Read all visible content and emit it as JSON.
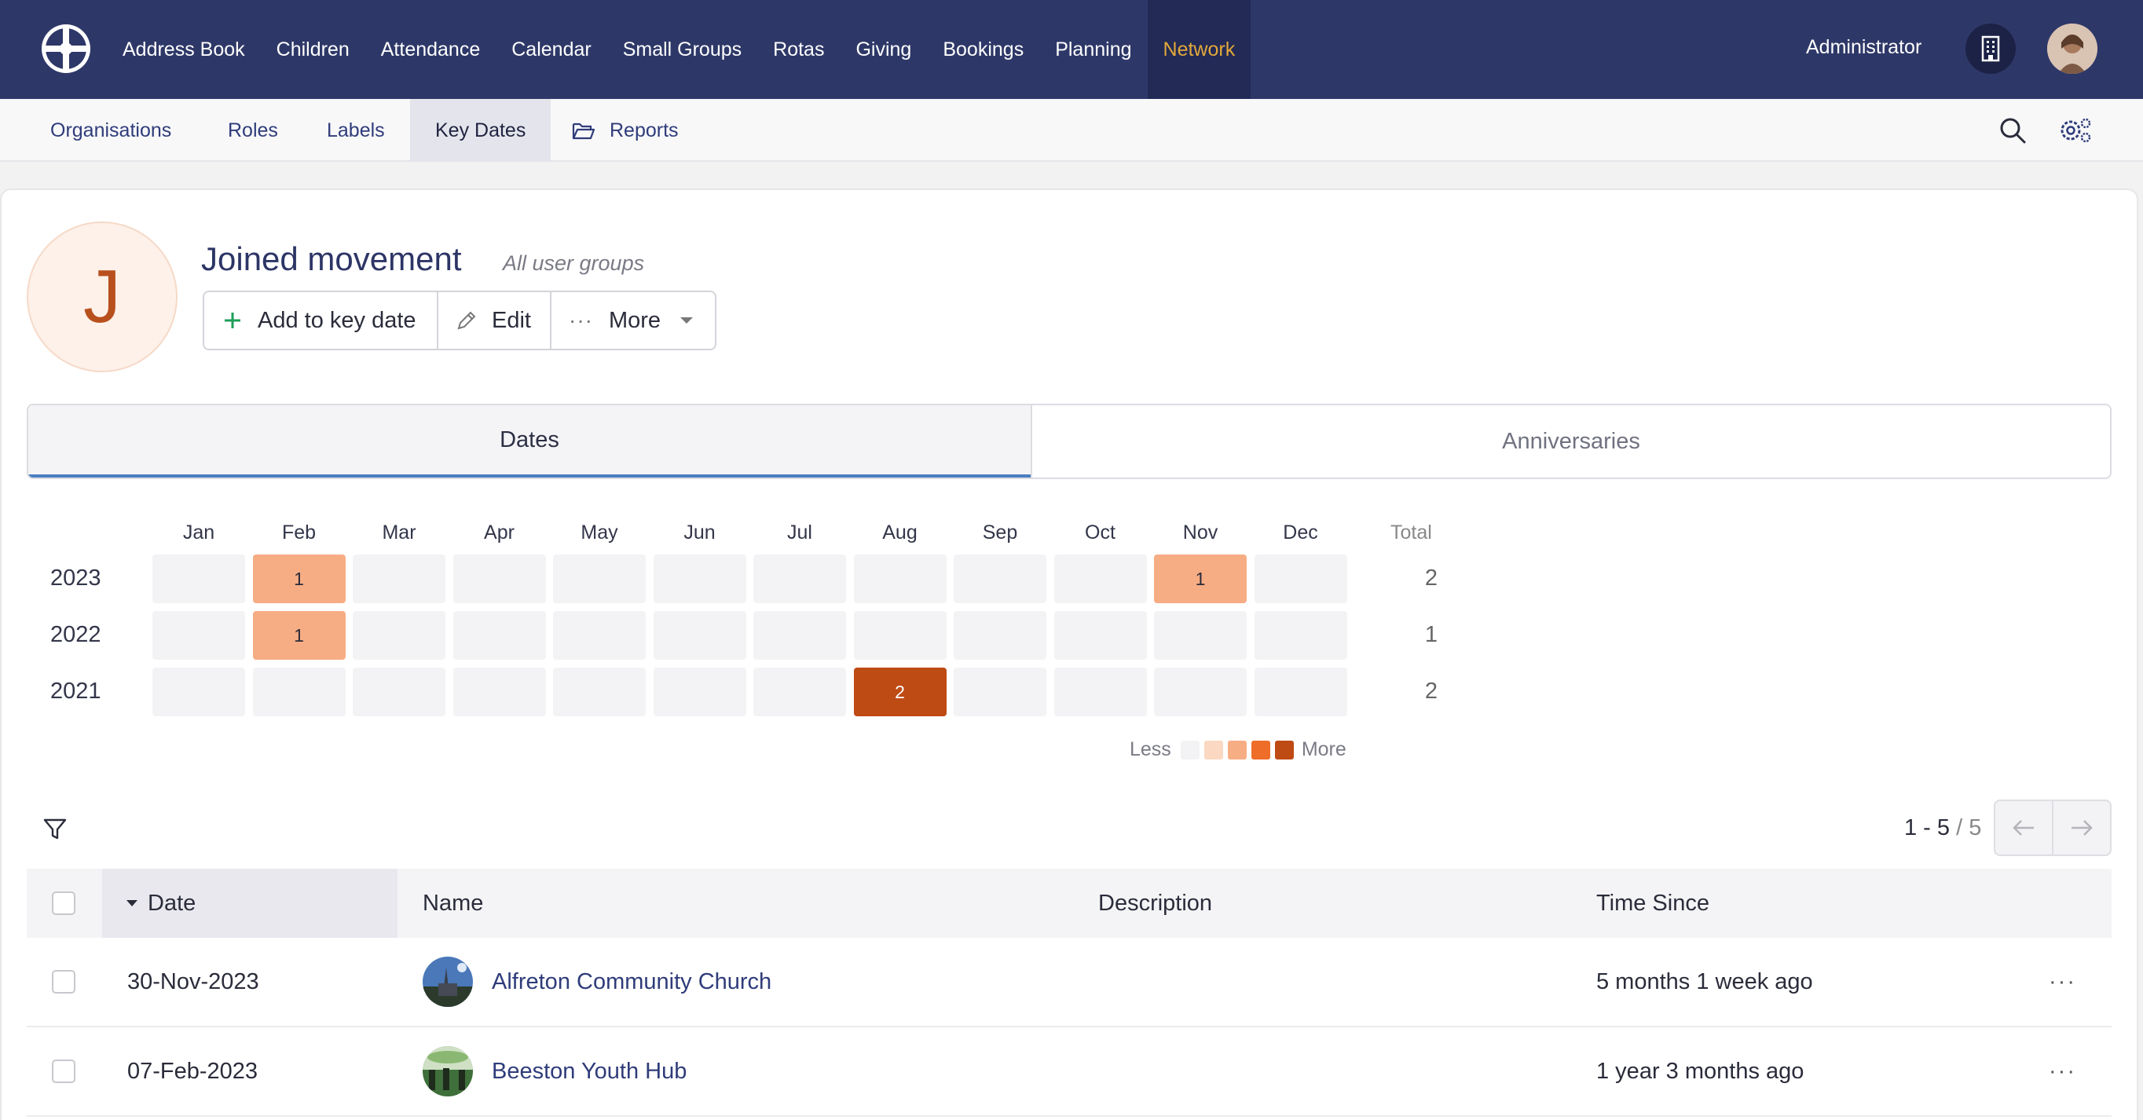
{
  "nav": {
    "items": [
      {
        "label": "Address Book"
      },
      {
        "label": "Children"
      },
      {
        "label": "Attendance"
      },
      {
        "label": "Calendar"
      },
      {
        "label": "Small Groups"
      },
      {
        "label": "Rotas"
      },
      {
        "label": "Giving"
      },
      {
        "label": "Bookings"
      },
      {
        "label": "Planning"
      },
      {
        "label": "Network"
      }
    ],
    "active": "Network",
    "user_label": "Administrator"
  },
  "subnav": {
    "items": [
      {
        "label": "Organisations"
      },
      {
        "label": "Roles"
      },
      {
        "label": "Labels"
      },
      {
        "label": "Key Dates"
      },
      {
        "label": "Reports"
      }
    ],
    "active": "Key Dates"
  },
  "keydate": {
    "avatar_letter": "J",
    "title": "Joined movement",
    "subtitle": "All user groups",
    "add_label": "Add to key date",
    "edit_label": "Edit",
    "more_label": "More"
  },
  "tabs": [
    {
      "label": "Dates"
    },
    {
      "label": "Anniversaries"
    }
  ],
  "heatmap": {
    "months": [
      "Jan",
      "Feb",
      "Mar",
      "Apr",
      "May",
      "Jun",
      "Jul",
      "Aug",
      "Sep",
      "Oct",
      "Nov",
      "Dec"
    ],
    "total_label": "Total",
    "rows": [
      {
        "year": "2023",
        "counts": [
          0,
          1,
          0,
          0,
          0,
          0,
          0,
          0,
          0,
          0,
          1,
          0
        ],
        "total": "2"
      },
      {
        "year": "2022",
        "counts": [
          0,
          1,
          0,
          0,
          0,
          0,
          0,
          0,
          0,
          0,
          0,
          0
        ],
        "total": "1"
      },
      {
        "year": "2021",
        "counts": [
          0,
          0,
          0,
          0,
          0,
          0,
          0,
          2,
          0,
          0,
          0,
          0
        ],
        "total": "2"
      }
    ],
    "legend_less": "Less",
    "legend_more": "More",
    "colors": [
      "#f3f3f5",
      "#fbd8c1",
      "#f7ad84",
      "#ee6d28",
      "#be4a14"
    ]
  },
  "pagination": {
    "range": "1 - 5",
    "total": "/ 5"
  },
  "table": {
    "headers": {
      "date": "Date",
      "name": "Name",
      "description": "Description",
      "time_since": "Time Since"
    },
    "rows": [
      {
        "date": "30-Nov-2023",
        "name": "Alfreton Community Church",
        "description": "",
        "time_since": "5 months 1 week ago"
      },
      {
        "date": "07-Feb-2023",
        "name": "Beeston Youth Hub",
        "description": "",
        "time_since": "1 year 3 months ago"
      }
    ]
  }
}
